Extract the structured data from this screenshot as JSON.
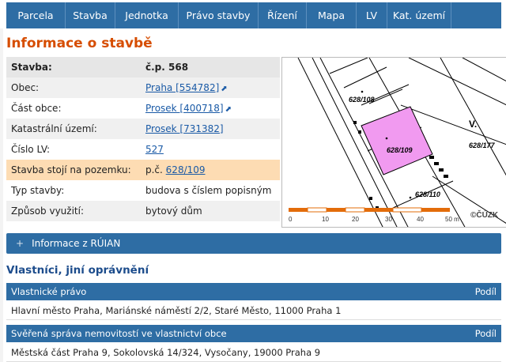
{
  "nav": [
    "Parcela",
    "Stavba",
    "Jednotka",
    "Právo stavby",
    "Řízení",
    "Mapa",
    "LV",
    "Kat. území"
  ],
  "title": "Informace o stavbě",
  "info": {
    "stavba_label": "Stavba:",
    "stavba_value": "č.p. 568",
    "obec_label": "Obec:",
    "obec_value": "Praha [554782]",
    "cast_label": "Část obce:",
    "cast_value": "Prosek [400718]",
    "ku_label": "Katastrální území:",
    "ku_value": "Prosek [731382]",
    "lv_label": "Číslo LV:",
    "lv_value": "527",
    "pozemek_label": "Stavba stojí na pozemku:",
    "pozemek_prefix": "p.č.",
    "pozemek_value": "628/109",
    "typ_label": "Typ stavby:",
    "typ_value": "budova s číslem popisným",
    "vyuziti_label": "Způsob využití:",
    "vyuziti_value": "bytový dům"
  },
  "map": {
    "parcels": [
      "628/108",
      "628/109",
      "628/110",
      "628/177"
    ],
    "letter": "V.",
    "scale": [
      "0",
      "10",
      "20",
      "30",
      "40",
      "50 m"
    ],
    "copyright": "©ČÚZK",
    "highlight_color": "#f19af0"
  },
  "ruian_label": "Informace z RÚIAN",
  "owners_title": "Vlastníci, jiní oprávnění",
  "sections": [
    {
      "title": "Vlastnické právo",
      "col": "Podíl",
      "row": "Hlavní město Praha, Mariánské náměstí 2/2, Staré Město, 11000 Praha 1"
    },
    {
      "title": "Svěřená správa nemovitostí ve vlastnictví obce",
      "col": "Podíl",
      "row": "Městská část Praha 9, Sokolovská 14/324, Vysočany, 19000 Praha 9"
    }
  ]
}
